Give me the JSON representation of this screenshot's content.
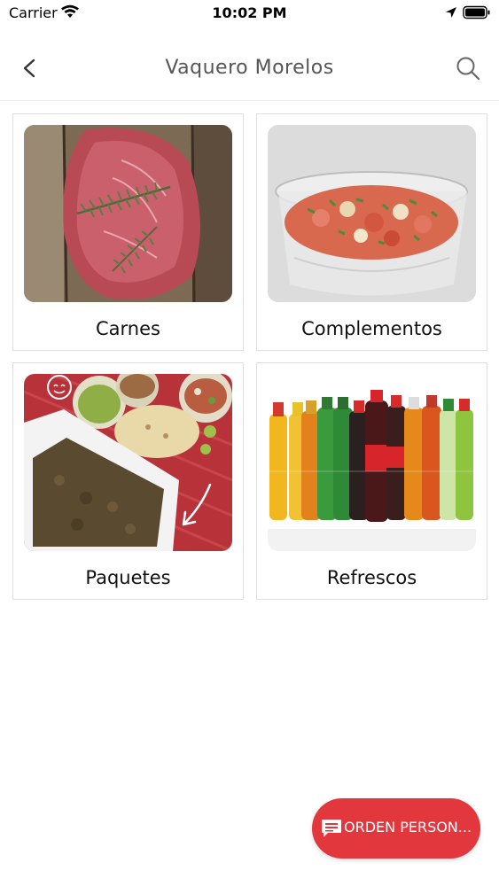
{
  "status_bar": {
    "carrier": "Carrier",
    "time": "10:02 PM",
    "icons": [
      "wifi-icon",
      "location-icon",
      "battery-icon"
    ]
  },
  "nav": {
    "title": "Vaquero Morelos",
    "back_icon": "back-icon",
    "search_icon": "search-icon"
  },
  "categories": [
    {
      "label": "Carnes",
      "image": "meat-steak-image"
    },
    {
      "label": "Complementos",
      "image": "pico-de-gallo-image"
    },
    {
      "label": "Paquetes",
      "image": "tacos-package-image"
    },
    {
      "label": "Refrescos",
      "image": "soft-drinks-image"
    }
  ],
  "fab": {
    "label": "ORDEN PERSON...",
    "icon": "chat-icon"
  },
  "colors": {
    "accent": "#e2373d",
    "title": "#555555",
    "card_border": "#dedede"
  }
}
